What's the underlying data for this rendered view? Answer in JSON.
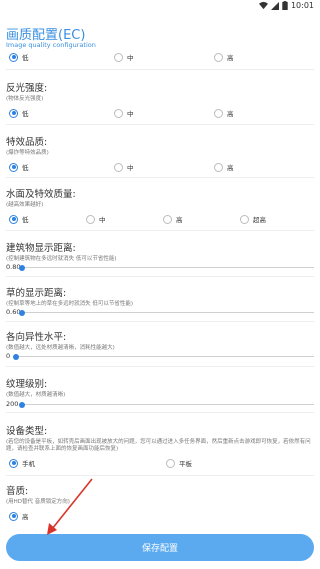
{
  "status_bar": {
    "time": "10:01"
  },
  "header": {
    "title": "画质配置(EC)",
    "subtitle": "Image quality configuration"
  },
  "top_partial": {
    "options": [
      "低",
      "中",
      "高"
    ],
    "selected": 0
  },
  "sections": {
    "reflection": {
      "title": "反光强度:",
      "desc": "(物体反光强度)",
      "options": [
        "低",
        "中",
        "高"
      ],
      "selected": 0
    },
    "effects": {
      "title": "特效品质:",
      "desc": "(爆炸等特效品质)",
      "options": [
        "低",
        "中",
        "高"
      ],
      "selected": 0
    },
    "water": {
      "title": "水面及特效质量:",
      "desc": "(越高效果越好)",
      "options": [
        "低",
        "中",
        "高",
        "超高"
      ],
      "selected": 0
    },
    "building_distance": {
      "title": "建筑物显示距离:",
      "desc": "(控制建筑物在多远时就消失 低可以节省性能)",
      "value": "0.80",
      "level": 0.0
    },
    "grass_distance": {
      "title": "草的显示距离:",
      "desc": "(控制草等地上的草在多远时就消失 低可以节省性能)",
      "value": "0.60",
      "level": 0.0
    },
    "anisotropy": {
      "title": "各向异性水平:",
      "desc": "(数值越大，远处材质越清晰，消耗性能越大)",
      "value": "0",
      "level": 0.0
    },
    "texture": {
      "title": "纹理级别:",
      "desc": "(数值越大，材质越清晰)",
      "value": "200",
      "level": 0.0
    },
    "device": {
      "title": "设备类型:",
      "desc": "(若您的设备是平板，如转壳后画面出现被放大的问题，您可以通过进入多任务界面，然后重新点击游戏即可恢复，若依然有问题，请检查并联系上面的恢复画面功能后恢复)",
      "options": [
        "手机",
        "平板"
      ],
      "selected": 0
    },
    "audio": {
      "title": "音质:",
      "desc": "(用HD替代 音质锁定方向)",
      "options": [
        "高"
      ],
      "selected": 0
    }
  },
  "save_button": {
    "label": "保存配置"
  },
  "colors": {
    "accent": "#2f82e0",
    "button": "#5baaf0",
    "title": "#3a8fe0",
    "arrow": "#d9342b"
  }
}
